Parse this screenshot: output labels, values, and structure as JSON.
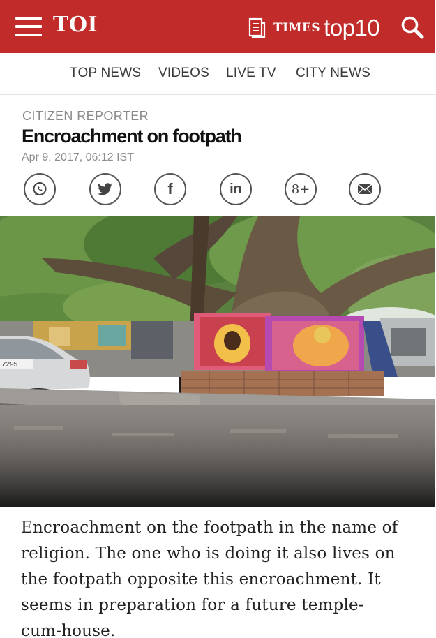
{
  "header": {
    "logo_text": "TOI",
    "top10_prefix": "TIMES",
    "top10_word": "top10",
    "brand_color": "#c12c2a",
    "icons": [
      "menu-icon",
      "document-icon",
      "search-icon"
    ]
  },
  "nav": {
    "items": [
      {
        "label": "TOP NEWS"
      },
      {
        "label": "VIDEOS"
      },
      {
        "label": "LIVE TV"
      },
      {
        "label": "CITY NEWS"
      }
    ]
  },
  "article": {
    "category": "CITIZEN REPORTER",
    "headline": "Encroachment on footpath",
    "dateline": "Apr 9, 2017, 06:12 IST",
    "share_icons": [
      "whatsapp-icon",
      "twitter-icon",
      "facebook-icon",
      "linkedin-icon",
      "google-plus-icon",
      "email-icon"
    ],
    "facebook_glyph": "f",
    "linkedin_glyph": "in",
    "googleplus_glyph": "8+",
    "photo": {
      "plate_text": "7295"
    },
    "body_lines": [
      "Encroachment on the footpath in the name of",
      "religion. The one who is doing it also lives on",
      "the footpath opposite this encroachment. It",
      "seems in preparation for a future temple-",
      "cum-house."
    ]
  }
}
